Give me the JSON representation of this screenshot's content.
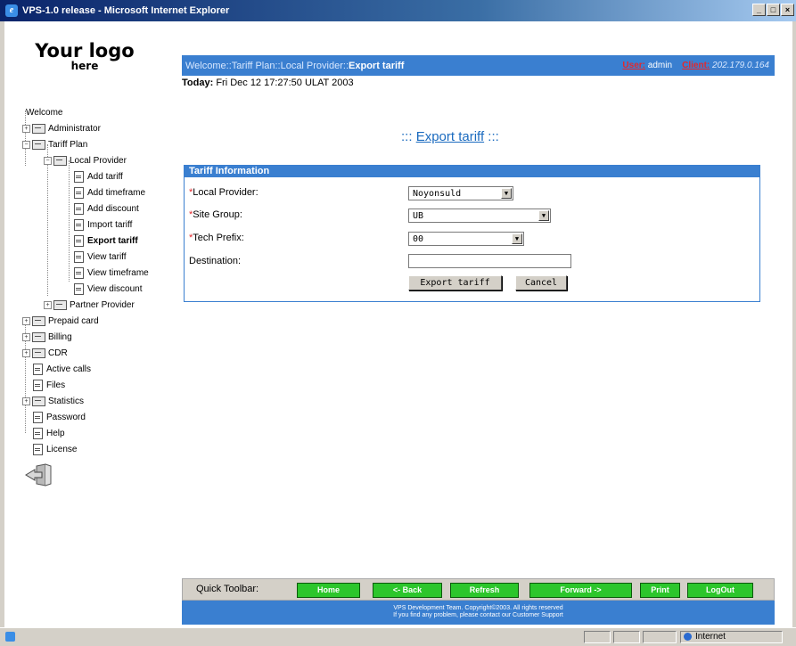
{
  "window": {
    "title": "VPS-1.0 release - Microsoft Internet Explorer",
    "minimize": "_",
    "maximize": "□",
    "close": "×"
  },
  "logo": {
    "line1": "Your logo",
    "line2": "here"
  },
  "tree": {
    "welcome": "Welcome",
    "administrator": "Administrator",
    "tariff_plan": "Tariff Plan",
    "local_provider": "Local Provider",
    "add_tariff": "Add tariff",
    "add_timeframe": "Add timeframe",
    "add_discount": "Add discount",
    "import_tariff": "Import tariff",
    "export_tariff": "Export tariff",
    "view_tariff": "View tariff",
    "view_timeframe": "View timeframe",
    "view_discount": "View discount",
    "partner_provider": "Partner Provider",
    "prepaid_card": "Prepaid card",
    "billing": "Billing",
    "cdr": "CDR",
    "active_calls": "Active calls",
    "files": "Files",
    "statistics": "Statistics",
    "password": "Password",
    "help": "Help",
    "license": "License",
    "expand": "+",
    "collapse": "−"
  },
  "header": {
    "breadcrumb": "Welcome::Tariff Plan::Local Provider::",
    "breadcrumb_current": "Export tariff",
    "user_label": "User:",
    "user_value": "admin",
    "client_label": "Client:",
    "client_value": "202.179.0.164",
    "today_label": "Today:",
    "today_value": "Fri Dec 12 17:27:50 ULAT 2003"
  },
  "page_title": {
    "prefix": ":::",
    "title": "Export tariff",
    "suffix": ":::"
  },
  "form": {
    "heading": "Tariff Information",
    "required_mark": "*",
    "local_provider_label": "Local Provider:",
    "local_provider_value": "Noyonsuld",
    "site_group_label": "Site Group:",
    "site_group_value": "UB",
    "tech_prefix_label": "Tech Prefix:",
    "tech_prefix_value": "00",
    "destination_label": "Destination:",
    "destination_value": "",
    "dropdown_arrow": "▼",
    "export_button": "Export tariff",
    "cancel_button": "Cancel"
  },
  "toolbar": {
    "label": "Quick Toolbar:",
    "home": "Home",
    "back": "<- Back",
    "refresh": "Refresh",
    "forward": "Forward ->",
    "print": "Print",
    "logout": "LogOut",
    "button_color": "#2cc62c"
  },
  "footer": {
    "line1": "VPS Development Team. Copyright©2003. All rights reserved",
    "line2": "If you find any problem, please contact our Customer Support"
  },
  "status": {
    "zone": "Internet"
  },
  "colors": {
    "accent": "#3a7fd0",
    "required": "#e4282c",
    "title_link": "#1b6bbf"
  }
}
